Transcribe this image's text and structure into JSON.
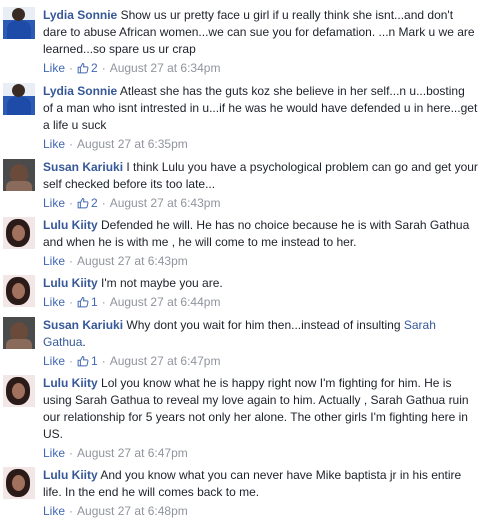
{
  "comments": [
    {
      "author": "Lydia Sonnie",
      "text": "Show us ur pretty face u girl if u really think she isnt...and don't dare to abuse African women...we can sue you for defamation. ...n Mark u we are learned...so spare us ur crap",
      "like_label": "Like",
      "likes": "2",
      "time": "August 27 at 6:34pm"
    },
    {
      "author": "Lydia Sonnie",
      "text": "Atleast she has the guts koz she believe in her self...n u...bosting of a man who isnt intrested in u...if he was he would have defended u in here...get a life u suck",
      "like_label": "Like",
      "time": "August 27 at 6:35pm"
    },
    {
      "author": "Susan Kariuki",
      "text": "I think Lulu you have a psychological problem can go and get your self checked before its too late...",
      "like_label": "Like",
      "likes": "2",
      "time": "August 27 at 6:43pm"
    },
    {
      "author": "Lulu Kiity",
      "text": "Defended he will. He has no choice because he is with Sarah Gathua and when he is with me , he will come to me instead to her.",
      "like_label": "Like",
      "time": "August 27 at 6:43pm"
    },
    {
      "author": "Lulu Kiity",
      "text": "I'm not maybe you are.",
      "like_label": "Like",
      "likes": "1",
      "time": "August 27 at 6:44pm"
    },
    {
      "author": "Susan Kariuki",
      "text": "Why dont you wait for him then...instead of insulting",
      "mention": "Sarah Gathua",
      "text_after": ".",
      "like_label": "Like",
      "likes": "1",
      "time": "August 27 at 6:47pm"
    },
    {
      "author": "Lulu Kiity",
      "text": "Lol you know what he is happy right now I'm fighting for him. He is using Sarah Gathua to reveal my love again to him. Actually , Sarah Gathua ruin our relationship for 5 years not only her alone. The other girls I'm fighting here in US.",
      "like_label": "Like",
      "time": "August 27 at 6:47pm"
    },
    {
      "author": "Lulu Kiity",
      "text": "And you know what you can never have Mike baptista jr in his entire life. In the end he will comes back to me.",
      "like_label": "Like",
      "time": "August 27 at 6:48pm"
    }
  ],
  "separator": "·",
  "colors": {
    "author": "#365899",
    "meta": "#90949c",
    "like": "#4267b2"
  },
  "icons": {
    "like_count": "thumbs-up-icon"
  }
}
